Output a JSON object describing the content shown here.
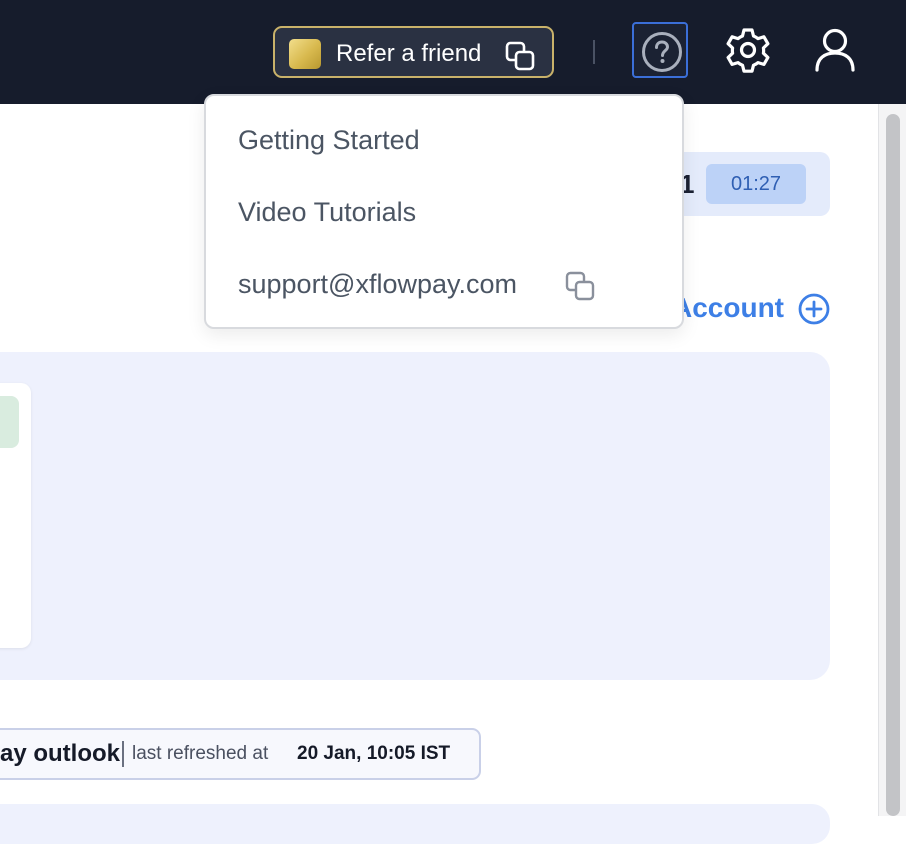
{
  "topbar": {
    "refer_label": "Refer a friend"
  },
  "help_menu": {
    "items": [
      "Getting Started",
      "Video Tutorials",
      "support@xflowpay.com"
    ]
  },
  "timer": {
    "digit": "1",
    "badge": "01:27"
  },
  "accounts": {
    "add_label": "Account"
  },
  "outlook": {
    "title": "ay outlook",
    "subtitle": "last refreshed at",
    "time": "20 Jan, 10:05 IST"
  },
  "colors": {
    "topbar_bg": "#161c2c",
    "accent_blue": "#3d7fe6",
    "gold_border": "#c9b26a",
    "panel_bg": "#eef1fd"
  },
  "icons": [
    "copy-icon",
    "help-icon",
    "gear-icon",
    "user-icon",
    "plus-circle-icon"
  ]
}
